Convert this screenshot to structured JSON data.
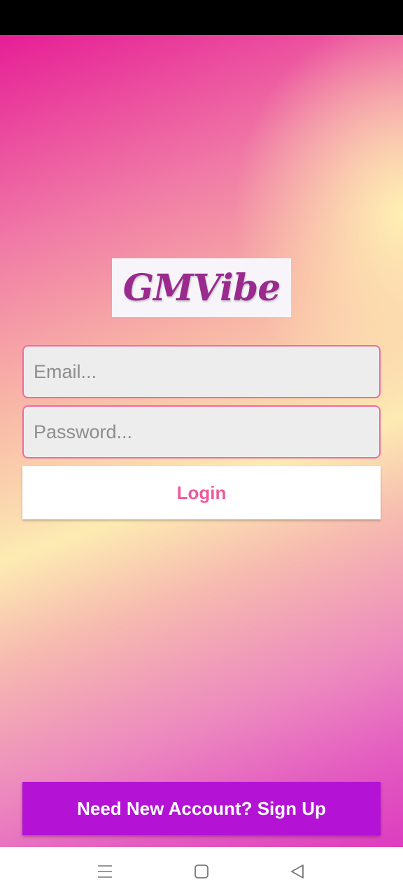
{
  "logo": {
    "text": "GMVibe"
  },
  "form": {
    "email_placeholder": "Email...",
    "password_placeholder": "Password...",
    "login_label": "Login"
  },
  "signup": {
    "label": "Need New Account? Sign Up"
  },
  "nav": {
    "menu_icon": "menu-icon",
    "home_icon": "square-home-icon",
    "back_icon": "triangle-back-icon"
  },
  "colors": {
    "accent_pink": "#ee5a9c",
    "signup_purple": "#b413d6",
    "logo_purple": "#9a2a8e"
  }
}
